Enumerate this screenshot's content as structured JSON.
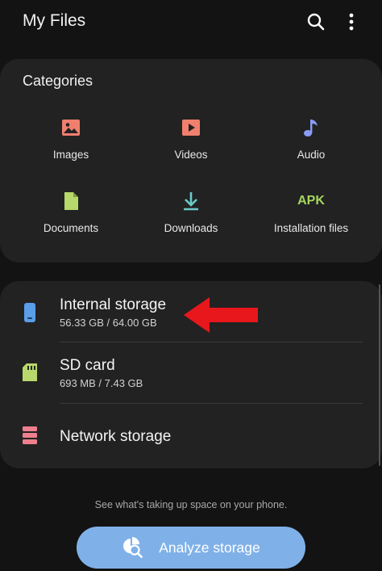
{
  "header": {
    "title": "My Files",
    "search_icon": "search-icon",
    "more_icon": "more-vertical-icon"
  },
  "categories": {
    "title": "Categories",
    "items": [
      {
        "label": "Images",
        "icon": "image-icon",
        "color": "#f07f6e"
      },
      {
        "label": "Videos",
        "icon": "video-icon",
        "color": "#f07f6e"
      },
      {
        "label": "Audio",
        "icon": "music-note-icon",
        "color": "#8a9cf5"
      },
      {
        "label": "Documents",
        "icon": "document-icon",
        "color": "#b7d86a"
      },
      {
        "label": "Downloads",
        "icon": "download-icon",
        "color": "#6cc9c9"
      },
      {
        "label": "Installation files",
        "icon": "apk-icon",
        "icon_text": "APK",
        "color": "#a4d65e"
      }
    ]
  },
  "storage": {
    "items": [
      {
        "title": "Internal storage",
        "subtitle": "56.33 GB / 64.00 GB",
        "icon": "phone-icon",
        "color": "#5a9de8"
      },
      {
        "title": "SD card",
        "subtitle": "693 MB / 7.43 GB",
        "icon": "sd-card-icon",
        "color": "#b7d86a"
      },
      {
        "title": "Network storage",
        "subtitle": "",
        "icon": "server-icon",
        "color": "#f07f8e"
      }
    ]
  },
  "footer": {
    "hint": "See what's taking up space on your phone.",
    "analyze_label": "Analyze storage",
    "analyze_icon": "analyze-icon",
    "accent": "#7fb1e8"
  },
  "annotation": {
    "arrow_color": "#e8171b"
  }
}
